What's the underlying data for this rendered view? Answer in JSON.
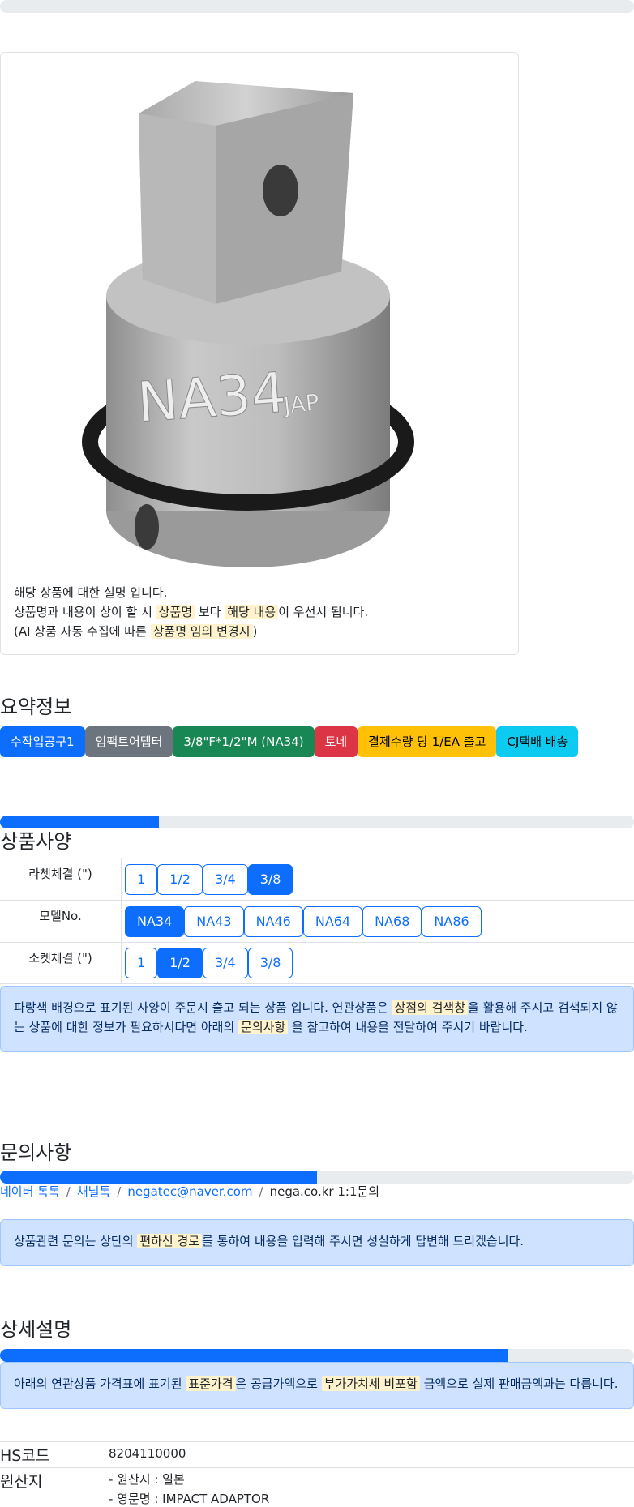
{
  "card": {
    "image_alt": "NA34 impact adaptor",
    "engraving": "NA34",
    "engraving_small": "JAP",
    "line1": "해당 상품에 대한 설명 입니다.",
    "line2_a": "상품명과 내용이 상이 할 시",
    "line2_hl1": "상품명",
    "line2_b": "보다",
    "line2_hl2": "해당 내용",
    "line2_c": "이 우선시 됩니다.",
    "line3_a": "(AI 상품 자동 수집에 따른",
    "line3_hl": "상품명 임의 변경시",
    "line3_b": ")"
  },
  "summary": {
    "title": "요약정보",
    "badges": [
      {
        "label": "수작업공구1",
        "bg": "#0d6efd",
        "fg": "#ffffff"
      },
      {
        "label": "임팩트어댑터",
        "bg": "#6c757d",
        "fg": "#ffffff"
      },
      {
        "label": "3/8\"F*1/2\"M (NA34)",
        "bg": "#198754",
        "fg": "#ffffff"
      },
      {
        "label": "토네",
        "bg": "#dc3545",
        "fg": "#ffffff"
      },
      {
        "label": "결제수량 당 1/EA 출고",
        "bg": "#ffc107",
        "fg": "#000000"
      },
      {
        "label": "CJ택배 배송",
        "bg": "#0dcaf0",
        "fg": "#000000"
      }
    ]
  },
  "specs": {
    "title": "상품사양",
    "progress": 0.25,
    "rows": [
      {
        "label": "라쳇체결 (\")",
        "options": [
          "1",
          "1/2",
          "3/4",
          "3/8"
        ],
        "active": "3/8"
      },
      {
        "label": "모델No.",
        "options": [
          "NA34",
          "NA43",
          "NA46",
          "NA64",
          "NA68",
          "NA86"
        ],
        "active": "NA34"
      },
      {
        "label": "소켓체결 (\")",
        "options": [
          "1",
          "1/2",
          "3/4",
          "3/8"
        ],
        "active": "1/2"
      }
    ],
    "notice_a": "파랑색 배경으로 표기된 사양이 주문시 출고 되는 상품 입니다. 연관상품은",
    "notice_hl1": "상점의 검색창",
    "notice_b": "을 활용해 주시고 검색되지 않는 상품에 대한 정보가 필요하시다면 아래의",
    "notice_hl2": "문의사항",
    "notice_c": "을 참고하여 내용을 전달하여 주시기 바랍니다."
  },
  "inquiry": {
    "title": "문의사항",
    "progress": 0.5,
    "links": [
      "네이버 톡톡",
      "채널톡",
      "negatec@naver.com"
    ],
    "plain": "nega.co.kr 1:1문의",
    "separator": "/",
    "notice_a": "상품관련 문의는 상단의",
    "notice_hl": "편하신 경로",
    "notice_b": "를 통하여 내용을 입력해 주시면 성실하게 답변해 드리겠습니다."
  },
  "detail": {
    "title": "상세설명",
    "progress": 0.8,
    "notice_a": "아래의 연관상품 가격표에 표기된",
    "notice_hl1": "표준가격",
    "notice_b": "은 공급가액으로",
    "notice_hl2": "부가가치세 비포함",
    "notice_c": "금액으로 실제 판매금액과는 다릅니다."
  },
  "info": {
    "hs_key": "HS코드",
    "hs_val": "8204110000",
    "origin_key": "원산지",
    "origin_line1": "- 원산지 : 일본",
    "origin_line2": "- 영문명 : IMPACT ADAPTOR"
  }
}
